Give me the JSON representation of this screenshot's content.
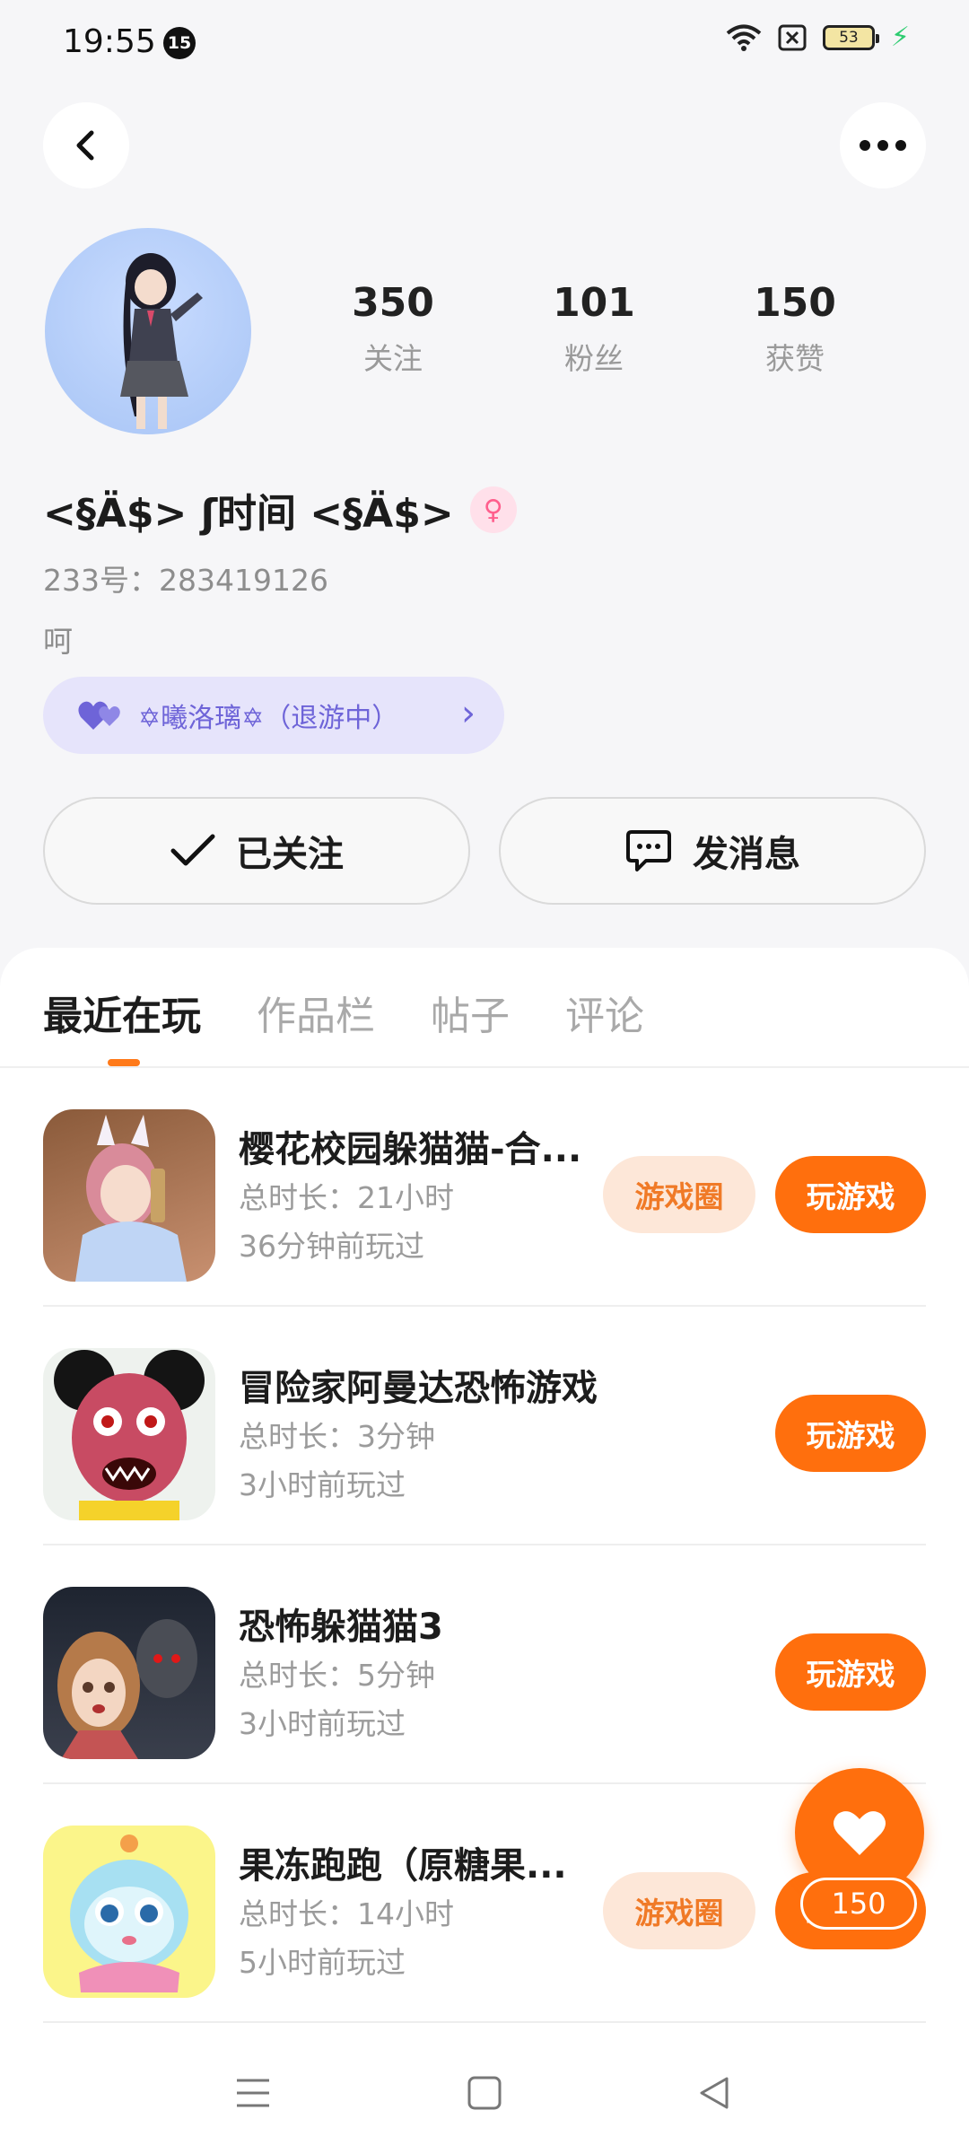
{
  "status_bar": {
    "time": "19:55",
    "notification_count": "15",
    "battery": "53"
  },
  "profile": {
    "stats": [
      {
        "value": "350",
        "label": "关注"
      },
      {
        "value": "101",
        "label": "粉丝"
      },
      {
        "value": "150",
        "label": "获赞"
      }
    ],
    "username": "<§Ä$> ʃ时间 <§Ä$>",
    "user_id": "233号：283419126",
    "bio": "呵",
    "relation_text": "✡曦洛璃✡（退游中）",
    "follow_label": "已关注",
    "message_label": "发消息"
  },
  "tabs": [
    "最近在玩",
    "作品栏",
    "帖子",
    "评论"
  ],
  "games": [
    {
      "title": "樱花校园躲猫猫-合...",
      "duration": "总时长：21小时",
      "last_played": "36分钟前玩过",
      "circle_label": "游戏圈",
      "play_label": "玩游戏"
    },
    {
      "title": "冒险家阿曼达恐怖游戏",
      "duration": "总时长：3分钟",
      "last_played": "3小时前玩过",
      "play_label": "玩游戏"
    },
    {
      "title": "恐怖躲猫猫3",
      "duration": "总时长：5分钟",
      "last_played": "3小时前玩过",
      "play_label": "玩游戏"
    },
    {
      "title": "果冻跑跑（原糖果...",
      "duration": "总时长：14小时",
      "last_played": "5小时前玩过",
      "circle_label": "游戏圈",
      "play_label": "玩游戏"
    }
  ],
  "like_fab": {
    "count": "150"
  },
  "colors": {
    "accent": "#ff6f0d",
    "relation_pill": "#e6e4fb",
    "relation_text": "#6e64d8"
  }
}
